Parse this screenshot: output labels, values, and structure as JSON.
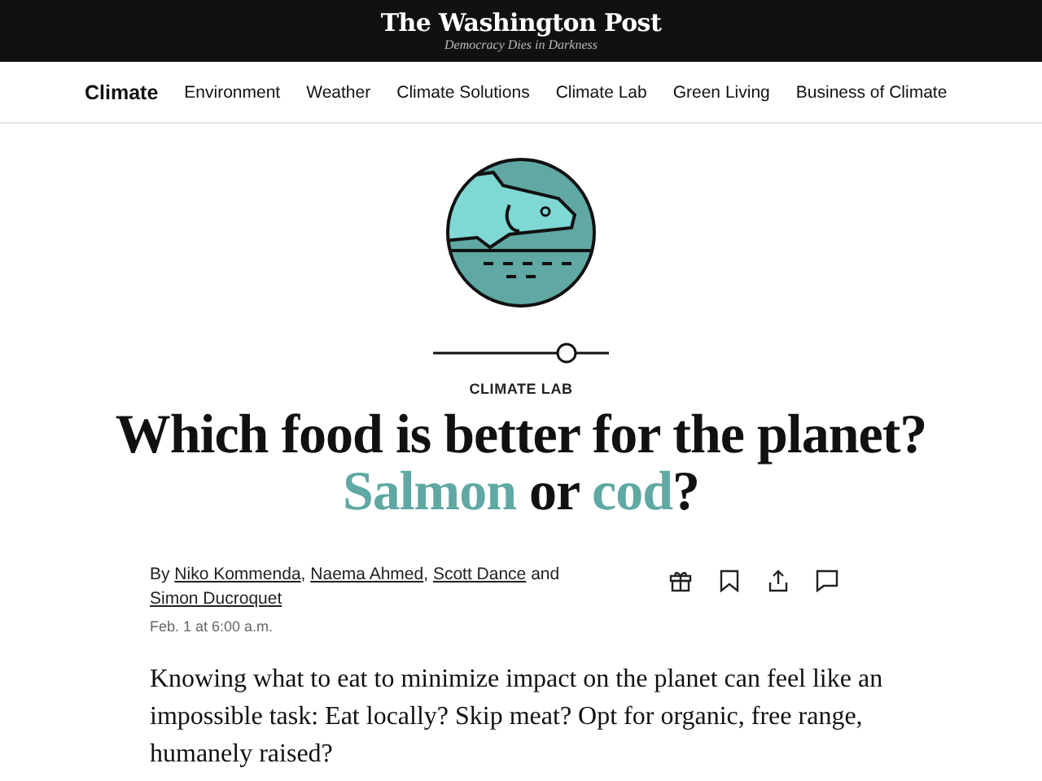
{
  "masthead": {
    "logo": "The Washington Post",
    "tagline": "Democracy Dies in Darkness"
  },
  "nav": {
    "items": [
      {
        "label": "Climate",
        "selected": true
      },
      {
        "label": "Environment",
        "selected": false
      },
      {
        "label": "Weather",
        "selected": false
      },
      {
        "label": "Climate Solutions",
        "selected": false
      },
      {
        "label": "Climate Lab",
        "selected": false
      },
      {
        "label": "Green Living",
        "selected": false
      },
      {
        "label": "Business of Climate",
        "selected": false
      }
    ]
  },
  "article": {
    "kicker": "CLIMATE LAB",
    "headline": [
      [
        {
          "text": "Which food is better for the planet?",
          "highlighted": false
        }
      ],
      [
        {
          "text": "Salmon",
          "highlighted": true
        },
        {
          "text": " or ",
          "highlighted": false
        },
        {
          "text": "cod",
          "highlighted": true
        },
        {
          "text": "?",
          "highlighted": false
        }
      ]
    ],
    "byline": {
      "prefix": "By ",
      "authors": [
        {
          "name": "Niko Kommenda",
          "separator": ", "
        },
        {
          "name": "Naema Ahmed",
          "separator": ", "
        },
        {
          "name": "Scott Dance",
          "separator": " and "
        },
        {
          "name": "Simon Ducroquet"
        }
      ]
    },
    "date": "Feb. 1 at 6:00 a.m.",
    "actions": [
      {
        "kind": "gift"
      },
      {
        "kind": "bookmark"
      },
      {
        "kind": "share"
      },
      {
        "kind": "comment"
      }
    ],
    "body": "Knowing what to eat to minimize impact on the planet can feel like an impossible task: Eat locally? Skip meat? Opt for organic, free range, humanely raised?"
  }
}
